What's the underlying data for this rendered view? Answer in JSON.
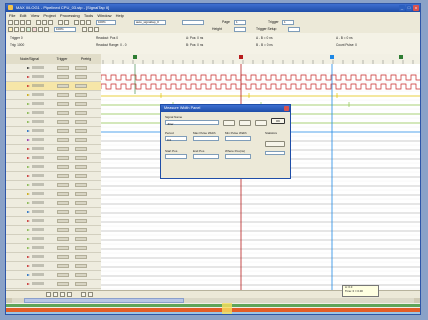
{
  "window": {
    "title": "MAX II/LOG1 - Pipelined CPU_03.stp - [SignalTap II]",
    "min": "_",
    "max": "□",
    "close": "x"
  },
  "menu": [
    "File",
    "Edit",
    "View",
    "Project",
    "Processing",
    "Tools",
    "Window",
    "Help"
  ],
  "toolbar1": {
    "zoom_value": "100%",
    "instance_value": "auto_signaltap_0",
    "trigger_label": "Trigger",
    "trigger_value": "1",
    "page_label": "Page",
    "page_value": "1"
  },
  "toolbar2": {
    "zoom_value": "100%",
    "height_label": "Height",
    "trigger_setup_label": "Trigger Setup"
  },
  "info": {
    "left1": "Trigger 0",
    "left2": "Trig: 1000",
    "mid1": "Readout: Pos 0",
    "mid2": "Readout Range: 0 - 0",
    "c1": "A: Pos: 0 ns",
    "c2": "B: Pos: 0 ns",
    "d1": "A - B = 0 ns",
    "d2": "B - B = 0 ns",
    "e1": "A - B = 0 ns",
    "e2": "Count Pulse: 0"
  },
  "columns": {
    "node": "Node/Signal",
    "trigger": "Trigger",
    "pretrigger": "Pretrig"
  },
  "dialog": {
    "title": "Measure Width Panel",
    "signal_label": "Signal Name",
    "signal_value": "Jitter",
    "ok": "OK",
    "period_label": "Period",
    "period_value": "0.0",
    "high_label": "Max Pulse Width",
    "low_label": "Min Pulse Width",
    "statistics_label": "Statistics",
    "start_label": "Start Pos",
    "end_label": "End Pos",
    "where_label": "Where Pos(ns)"
  },
  "note": {
    "line1": "A: 0.0",
    "line2": "Time: 0 = 0.00"
  },
  "colors": {
    "clock": "#c62828",
    "signal": "#7a7a7a",
    "cursor_a": "#b71c1c",
    "cursor_b": "#1e88e5",
    "cursor_c": "#2e7d32"
  }
}
